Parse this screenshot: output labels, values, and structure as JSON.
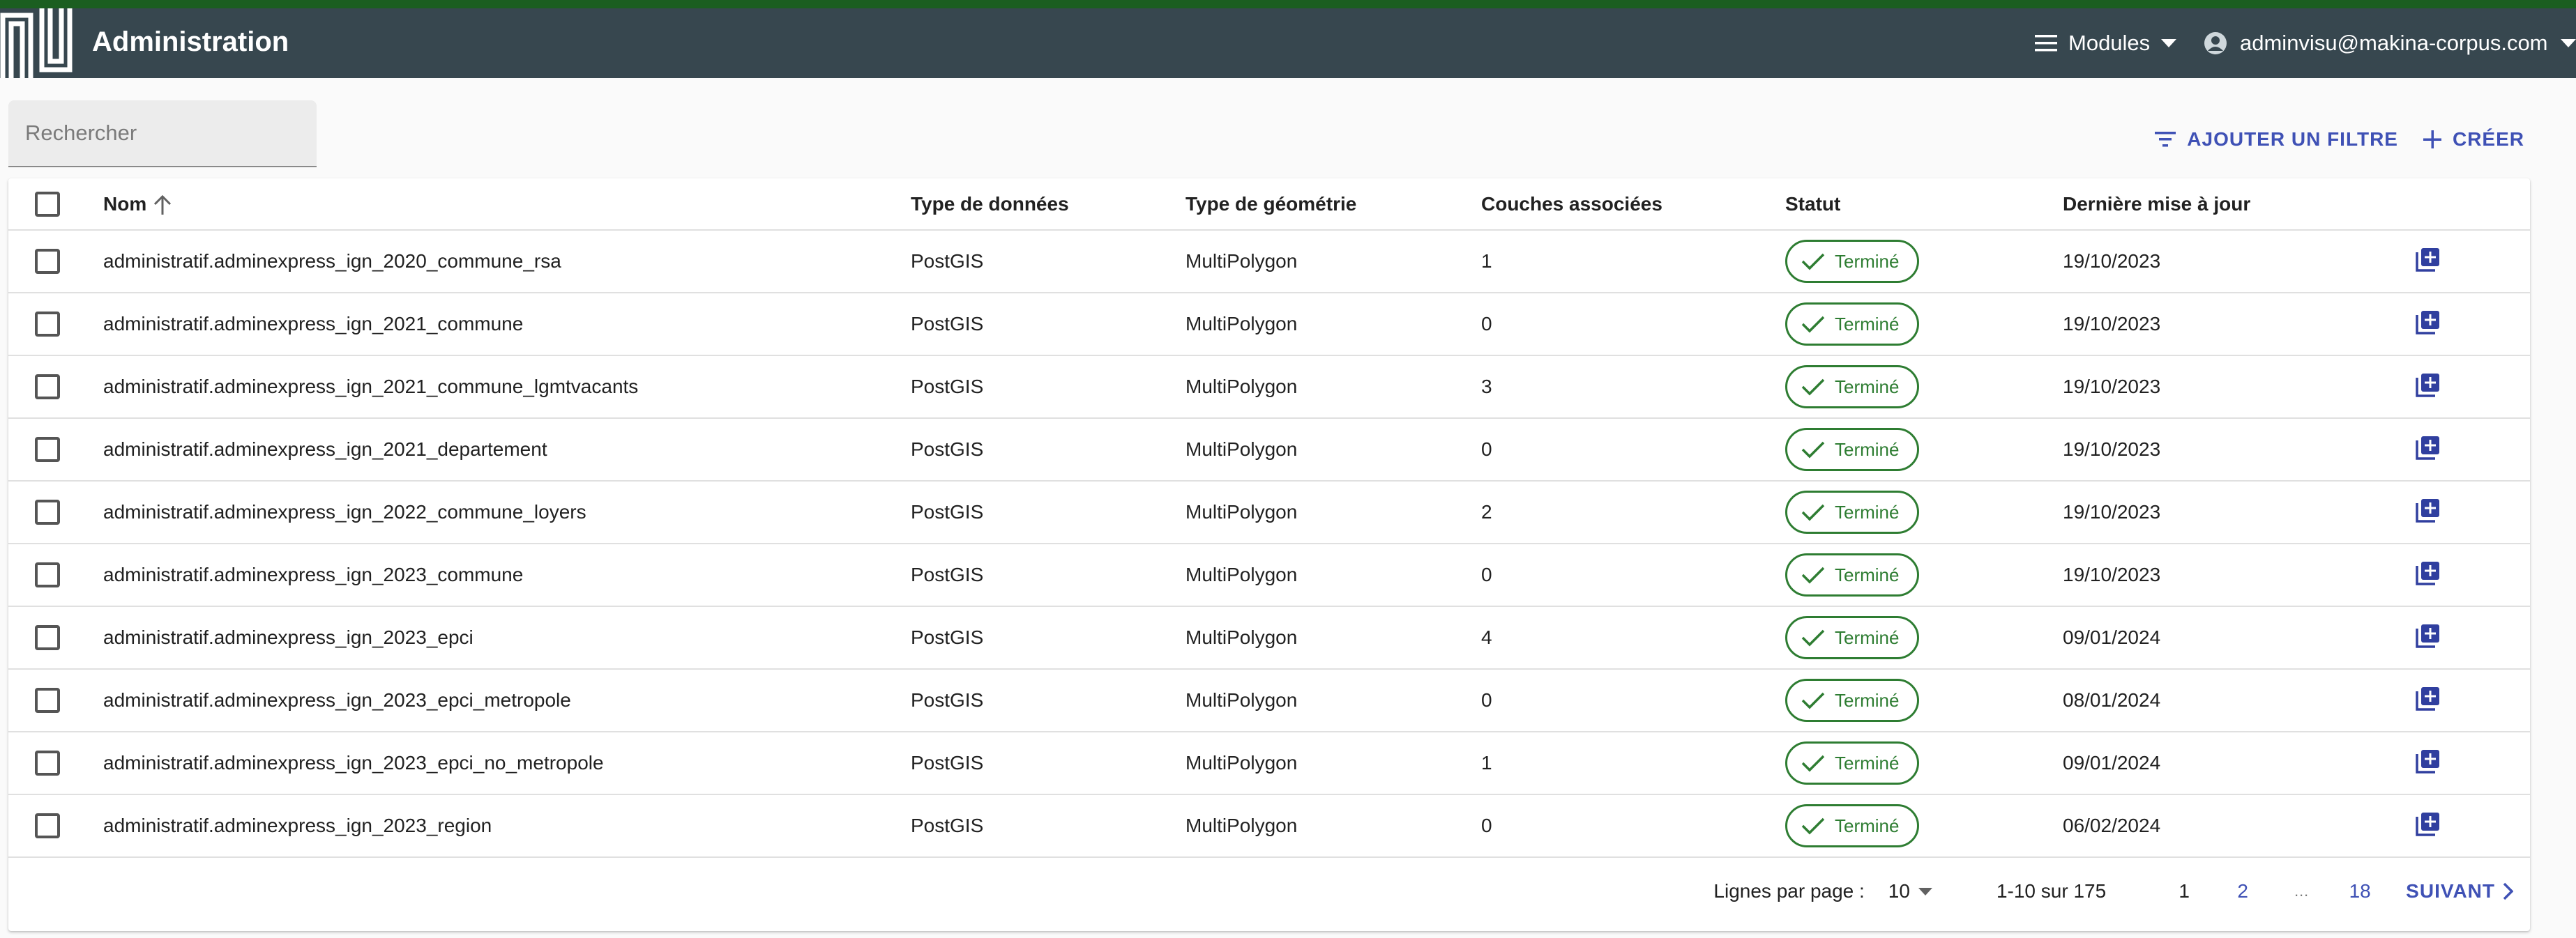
{
  "app": {
    "title": "Administration",
    "colors": {
      "appbar": "#37474f",
      "topstrip": "#1b5e20",
      "accent": "#3f51b5",
      "success": "#2e7d32"
    }
  },
  "header": {
    "modules_label": "Modules",
    "user_email": "adminvisu@makina-corpus.com"
  },
  "search": {
    "placeholder": "Rechercher",
    "value": ""
  },
  "actions": {
    "add_filter": "AJOUTER UN FILTRE",
    "create": "CRÉER"
  },
  "table": {
    "columns": [
      "Nom",
      "Type de données",
      "Type de géométrie",
      "Couches associées",
      "Statut",
      "Dernière mise à jour"
    ],
    "sort": {
      "column": "Nom",
      "direction": "ascending"
    },
    "rows": [
      {
        "name": "administratif.adminexpress_ign_2020_commune_rsa",
        "data_type": "PostGIS",
        "geometry": "MultiPolygon",
        "layers": "1",
        "status": "Terminé",
        "updated": "19/10/2023"
      },
      {
        "name": "administratif.adminexpress_ign_2021_commune",
        "data_type": "PostGIS",
        "geometry": "MultiPolygon",
        "layers": "0",
        "status": "Terminé",
        "updated": "19/10/2023"
      },
      {
        "name": "administratif.adminexpress_ign_2021_commune_lgmtvacants",
        "data_type": "PostGIS",
        "geometry": "MultiPolygon",
        "layers": "3",
        "status": "Terminé",
        "updated": "19/10/2023"
      },
      {
        "name": "administratif.adminexpress_ign_2021_departement",
        "data_type": "PostGIS",
        "geometry": "MultiPolygon",
        "layers": "0",
        "status": "Terminé",
        "updated": "19/10/2023"
      },
      {
        "name": "administratif.adminexpress_ign_2022_commune_loyers",
        "data_type": "PostGIS",
        "geometry": "MultiPolygon",
        "layers": "2",
        "status": "Terminé",
        "updated": "19/10/2023"
      },
      {
        "name": "administratif.adminexpress_ign_2023_commune",
        "data_type": "PostGIS",
        "geometry": "MultiPolygon",
        "layers": "0",
        "status": "Terminé",
        "updated": "19/10/2023"
      },
      {
        "name": "administratif.adminexpress_ign_2023_epci",
        "data_type": "PostGIS",
        "geometry": "MultiPolygon",
        "layers": "4",
        "status": "Terminé",
        "updated": "09/01/2024"
      },
      {
        "name": "administratif.adminexpress_ign_2023_epci_metropole",
        "data_type": "PostGIS",
        "geometry": "MultiPolygon",
        "layers": "0",
        "status": "Terminé",
        "updated": "08/01/2024"
      },
      {
        "name": "administratif.adminexpress_ign_2023_epci_no_metropole",
        "data_type": "PostGIS",
        "geometry": "MultiPolygon",
        "layers": "1",
        "status": "Terminé",
        "updated": "09/01/2024"
      },
      {
        "name": "administratif.adminexpress_ign_2023_region",
        "data_type": "PostGIS",
        "geometry": "MultiPolygon",
        "layers": "0",
        "status": "Terminé",
        "updated": "06/02/2024"
      }
    ]
  },
  "pagination": {
    "rows_per_page_label": "Lignes par page :",
    "rows_per_page": "10",
    "range": "1-10 sur 175",
    "pages": [
      "1",
      "2",
      "…",
      "18"
    ],
    "current_page": "1",
    "next_label": "SUIVANT"
  }
}
